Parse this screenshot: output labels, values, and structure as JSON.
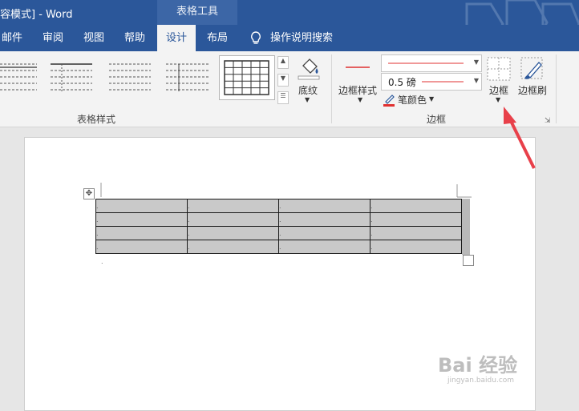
{
  "window": {
    "title": "容模式] - Word",
    "context_tab": "表格工具"
  },
  "tabs": [
    {
      "label": "邮件"
    },
    {
      "label": "审阅"
    },
    {
      "label": "视图"
    },
    {
      "label": "帮助"
    },
    {
      "label": "设计",
      "active": true
    },
    {
      "label": "布局"
    }
  ],
  "tell_me": {
    "label": "操作说明搜索",
    "icon": "lightbulb-icon"
  },
  "ribbon": {
    "table_styles": {
      "group_label": "表格样式",
      "shading_label": "底纹"
    },
    "borders": {
      "group_label": "边框",
      "border_styles_label": "边框样式",
      "line_weight": "0.5 磅",
      "pen_color_label": "笔颜色",
      "borders_label": "边框",
      "border_painter_label": "边框刷"
    }
  },
  "table": {
    "rows": [
      [
        ".",
        ".",
        ".",
        "."
      ],
      [
        ".",
        ".",
        ".",
        "."
      ],
      [
        ".",
        ".",
        ".",
        "."
      ],
      [
        ".",
        ".",
        ".",
        "."
      ]
    ]
  },
  "watermark": {
    "main": "Bai 经验",
    "sub": "jingyan.baidu.com"
  },
  "colors": {
    "word_blue": "#2b579a",
    "pen_red": "#e03030",
    "arrow_red": "#e8404a"
  }
}
